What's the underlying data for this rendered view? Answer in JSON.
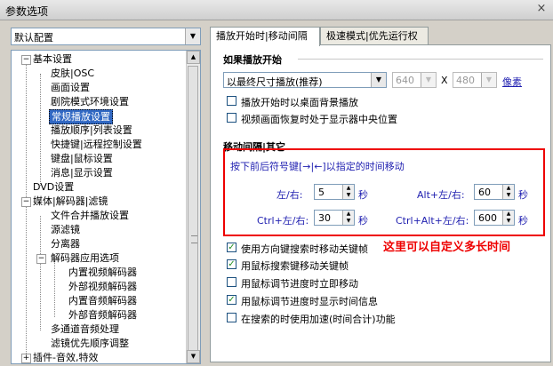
{
  "window": {
    "title": "参数选项",
    "close": "×"
  },
  "preset": {
    "value": "默认配置",
    "arrow": "▼"
  },
  "tree": {
    "items": [
      {
        "label": "基本设置",
        "toggle": "−"
      },
      {
        "label": "皮肤|OSC"
      },
      {
        "label": "画面设置"
      },
      {
        "label": "剧院模式环境设置"
      },
      {
        "label": "常规播放设置",
        "selected": true
      },
      {
        "label": "播放顺序|列表设置"
      },
      {
        "label": "快捷键|远程控制设置"
      },
      {
        "label": "键盘|鼠标设置"
      },
      {
        "label": "消息|显示设置"
      },
      {
        "label": "DVD设置"
      },
      {
        "label": "媒体|解码器|滤镜",
        "toggle": "−"
      },
      {
        "label": "文件合并播放设置"
      },
      {
        "label": "源滤镜"
      },
      {
        "label": "分离器"
      },
      {
        "label": "解码器应用选项",
        "toggle": "−"
      },
      {
        "label": "内置视频解码器"
      },
      {
        "label": "外部视频解码器"
      },
      {
        "label": "内置音频解码器"
      },
      {
        "label": "外部音频解码器"
      },
      {
        "label": "多通道音频处理"
      },
      {
        "label": "滤镜优先顺序调整"
      },
      {
        "label": "插件-音效,特效",
        "toggle": "+"
      }
    ]
  },
  "tabs": [
    {
      "label": "播放开始时|移动间隔",
      "active": true
    },
    {
      "label": "极速模式|优先运行权",
      "active": false
    }
  ],
  "start": {
    "title": "如果播放开始",
    "size_mode": "以最终尺寸播放(推荐)",
    "width": "640",
    "x_label": "X",
    "height": "480",
    "unit_link": "像素",
    "opt1": "播放开始时以桌面背景播放",
    "opt2": "视频画面恢复时处于显示器中央位置"
  },
  "move": {
    "title": "移动间隔|其它",
    "hint": "按下前后符号键[→|←]以指定的时间移动",
    "left_right_label": "左/右:",
    "left_right_value": "5",
    "alt_label": "Alt+左/右:",
    "alt_value": "60",
    "ctrl_label": "Ctrl+左/右:",
    "ctrl_value": "30",
    "ctrl_alt_label": "Ctrl+Alt+左/右:",
    "ctrl_alt_value": "600",
    "sec": "秒",
    "opt_dir": "使用方向键搜索时移动关键帧",
    "opt_mouse_key": "用鼠标搜索键移动关键帧",
    "opt_mouse_now": "用鼠标调节进度时立即移动",
    "opt_mouse_time": "用鼠标调节进度时显示时间信息",
    "opt_accel": "在搜索的时使用加速(时间合计)功能"
  },
  "annotation": "这里可以自定义多长时间",
  "colors": {
    "highlight": "#3168c3",
    "annotation": "#ee0000",
    "link": "#1f1fb0"
  }
}
